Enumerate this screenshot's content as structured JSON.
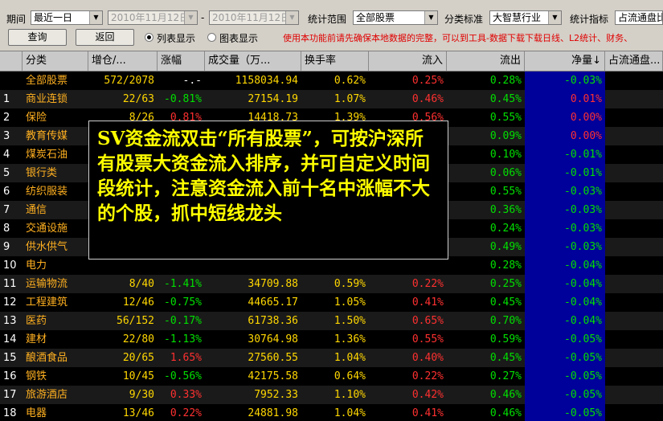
{
  "toolbar": {
    "period_label": "期间",
    "period_value": "最近一日",
    "date_from": "2010年11月12日",
    "date_sep": "-",
    "date_to": "2010年11月12日",
    "scope_label": "统计范围",
    "scope_value": "全部股票",
    "class_label": "分类标准",
    "class_value": "大智慧行业",
    "index_label": "统计指标",
    "index_value": "占流通盘比",
    "query_button": "查询",
    "back_button": "返回",
    "radio_list": "列表显示",
    "radio_chart": "图表显示",
    "notice": "使用本功能前请先确保本地数据的完整，可以到工具-数据下载下载日线、L2统计、财务、"
  },
  "table": {
    "headers": [
      "分类",
      "增仓/...",
      "涨幅",
      "成交量（万...",
      "换手率",
      "流入",
      "流出",
      "净量↓",
      "占流通盘..."
    ],
    "rows": [
      {
        "idx": "",
        "name": "全部股票",
        "zc": "572/2078",
        "zf": "-.-",
        "cjl": "1158034.94",
        "hsl": "0.62%",
        "lr": "0.25%",
        "lc": "0.28%",
        "jl": "-0.03%",
        "zf_color": "white"
      },
      {
        "idx": "1",
        "name": "商业连锁",
        "zc": "22/63",
        "zf": "-0.81%",
        "cjl": "27154.19",
        "hsl": "1.07%",
        "lr": "0.46%",
        "lc": "0.45%",
        "jl": "0.01%",
        "zf_color": "green"
      },
      {
        "idx": "2",
        "name": "保险",
        "zc": "8/26",
        "zf": "0.81%",
        "cjl": "14418.73",
        "hsl": "1.39%",
        "lr": "0.56%",
        "lc": "0.55%",
        "jl": "0.00%",
        "zf_color": "red"
      },
      {
        "idx": "3",
        "name": "教育传媒",
        "zc": "",
        "zf": "",
        "cjl": "",
        "hsl": "",
        "lr": "",
        "lc": "0.09%",
        "jl": "0.00%",
        "zf_color": "red"
      },
      {
        "idx": "4",
        "name": "煤炭石油",
        "zc": "",
        "zf": "",
        "cjl": "",
        "hsl": "",
        "lr": "",
        "lc": "0.10%",
        "jl": "-0.01%",
        "zf_color": "red"
      },
      {
        "idx": "5",
        "name": "银行类",
        "zc": "",
        "zf": "",
        "cjl": "",
        "hsl": "",
        "lr": "",
        "lc": "0.06%",
        "jl": "-0.01%",
        "zf_color": "red"
      },
      {
        "idx": "6",
        "name": "纺织服装",
        "zc": "",
        "zf": "",
        "cjl": "",
        "hsl": "",
        "lr": "",
        "lc": "0.55%",
        "jl": "-0.03%",
        "zf_color": "red"
      },
      {
        "idx": "7",
        "name": "通信",
        "zc": "",
        "zf": "",
        "cjl": "",
        "hsl": "",
        "lr": "",
        "lc": "0.36%",
        "jl": "-0.03%",
        "zf_color": "red"
      },
      {
        "idx": "8",
        "name": "交通设施",
        "zc": "",
        "zf": "",
        "cjl": "",
        "hsl": "",
        "lr": "",
        "lc": "0.24%",
        "jl": "-0.03%",
        "zf_color": "red"
      },
      {
        "idx": "9",
        "name": "供水供气",
        "zc": "",
        "zf": "",
        "cjl": "",
        "hsl": "",
        "lr": "",
        "lc": "0.49%",
        "jl": "-0.03%",
        "zf_color": "red"
      },
      {
        "idx": "10",
        "name": "电力",
        "zc": "",
        "zf": "",
        "cjl": "",
        "hsl": "",
        "lr": "",
        "lc": "0.28%",
        "jl": "-0.04%",
        "zf_color": "red"
      },
      {
        "idx": "11",
        "name": "运输物流",
        "zc": "8/40",
        "zf": "-1.41%",
        "cjl": "34709.88",
        "hsl": "0.59%",
        "lr": "0.22%",
        "lc": "0.25%",
        "jl": "-0.04%",
        "zf_color": "green"
      },
      {
        "idx": "12",
        "name": "工程建筑",
        "zc": "12/46",
        "zf": "-0.75%",
        "cjl": "44665.17",
        "hsl": "1.05%",
        "lr": "0.41%",
        "lc": "0.45%",
        "jl": "-0.04%",
        "zf_color": "green"
      },
      {
        "idx": "13",
        "name": "医药",
        "zc": "56/152",
        "zf": "-0.17%",
        "cjl": "61738.36",
        "hsl": "1.50%",
        "lr": "0.65%",
        "lc": "0.70%",
        "jl": "-0.04%",
        "zf_color": "green"
      },
      {
        "idx": "14",
        "name": "建材",
        "zc": "22/80",
        "zf": "-1.13%",
        "cjl": "30764.98",
        "hsl": "1.36%",
        "lr": "0.55%",
        "lc": "0.59%",
        "jl": "-0.05%",
        "zf_color": "green"
      },
      {
        "idx": "15",
        "name": "酿酒食品",
        "zc": "20/65",
        "zf": "1.65%",
        "cjl": "27560.55",
        "hsl": "1.04%",
        "lr": "0.40%",
        "lc": "0.45%",
        "jl": "-0.05%",
        "zf_color": "red"
      },
      {
        "idx": "16",
        "name": "钢铁",
        "zc": "10/45",
        "zf": "-0.56%",
        "cjl": "42175.58",
        "hsl": "0.64%",
        "lr": "0.22%",
        "lc": "0.27%",
        "jl": "-0.05%",
        "zf_color": "green"
      },
      {
        "idx": "17",
        "name": "旅游酒店",
        "zc": "9/30",
        "zf": "0.33%",
        "cjl": "7952.33",
        "hsl": "1.10%",
        "lr": "0.42%",
        "lc": "0.46%",
        "jl": "-0.05%",
        "zf_color": "red"
      },
      {
        "idx": "18",
        "name": "电器",
        "zc": "13/46",
        "zf": "0.22%",
        "cjl": "24881.98",
        "hsl": "1.04%",
        "lr": "0.41%",
        "lc": "0.46%",
        "jl": "-0.05%",
        "zf_color": "red"
      },
      {
        "idx": "19",
        "name": "农林牧渔",
        "zc": "13/44",
        "zf": "-1.19%",
        "cjl": "21612.69",
        "hsl": "1.66%",
        "lr": "0.60%",
        "lc": "0.66%",
        "jl": "-0.05%",
        "zf_color": "green"
      }
    ]
  },
  "overlay": {
    "text": "SV资金流双击“所有股票”，可按沪深所有股票大资金流入排序，并可自定义时间段统计，注意资金流入前十名中涨幅不大的个股，抓中短线龙头"
  },
  "colors": {
    "name": "#ffb020",
    "positive": "#ff3030",
    "negative": "#00e000",
    "highlight_col": "#00009a",
    "overlay_text": "#ffff00"
  }
}
